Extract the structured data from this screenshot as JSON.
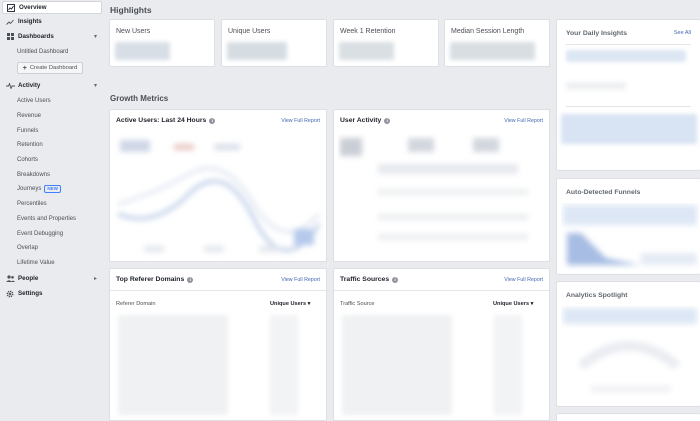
{
  "sidebar": {
    "overview": "Overview",
    "insights": "Insights",
    "dashboards": "Dashboards",
    "untitled_dashboard": "Untitled Dashboard",
    "create_dashboard": "Create Dashboard",
    "activity": "Activity",
    "activity_items": [
      "Active Users",
      "Revenue",
      "Funnels",
      "Retention",
      "Cohorts",
      "Breakdowns",
      "Journeys",
      "Percentiles",
      "Events and Properties",
      "Event Debugging",
      "Overlap",
      "Lifetime Value"
    ],
    "new_badge": "NEW",
    "people": "People",
    "settings": "Settings"
  },
  "highlights": {
    "title": "Highlights",
    "cards": [
      "New Users",
      "Unique Users",
      "Week 1 Retention",
      "Median Session Length"
    ]
  },
  "growth": {
    "title": "Growth Metrics",
    "active_users_title": "Active Users: Last 24 Hours",
    "user_activity_title": "User Activity",
    "referrer_title": "Top Referer Domains",
    "traffic_title": "Traffic Sources",
    "view_full_report": "View Full Report",
    "referrer_col": "Referer Domain",
    "traffic_col": "Traffic Source",
    "unique_users_col": "Unique Users"
  },
  "right_panel": {
    "daily_insights": "Your Daily Insights",
    "see_all": "See All",
    "auto_funnels": "Auto-Detected Funnels",
    "spotlight": "Analytics Spotlight"
  },
  "colors": {
    "accent": "#4267b2",
    "background": "#e9ebee",
    "card": "#ffffff"
  }
}
